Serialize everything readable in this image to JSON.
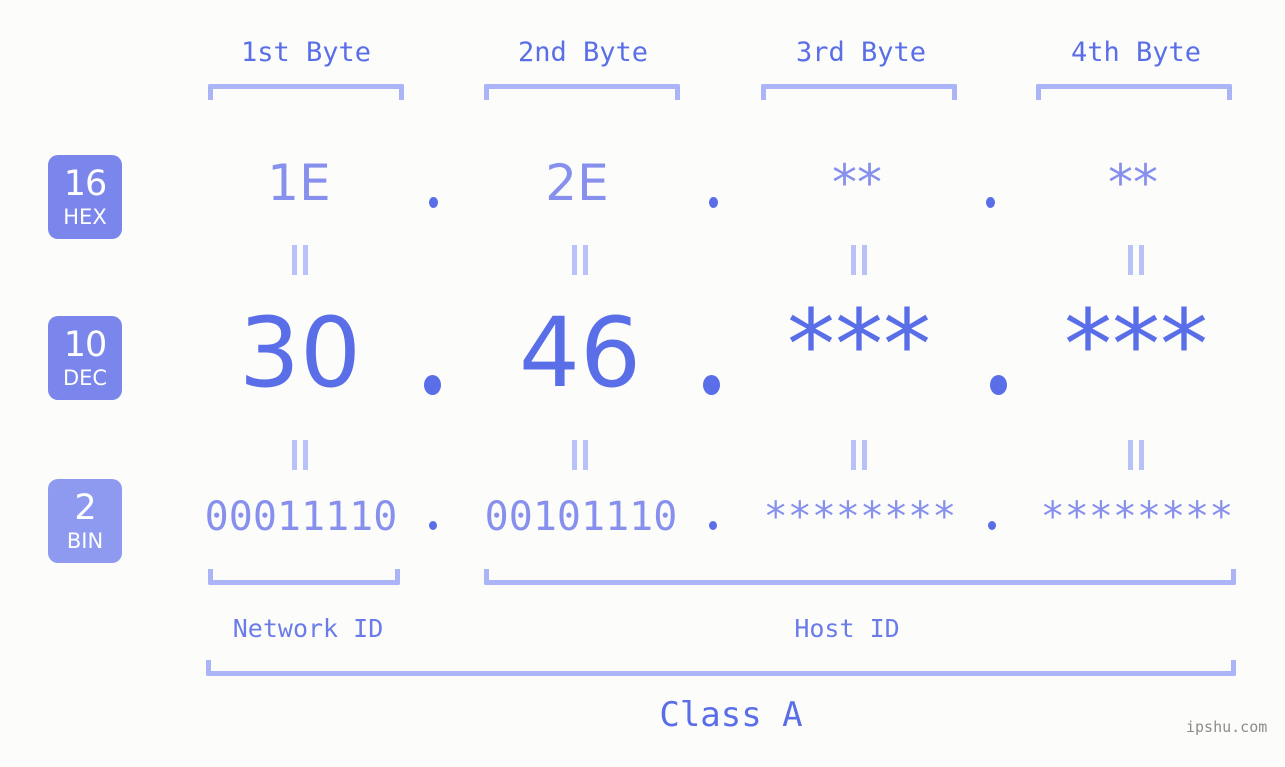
{
  "meta": {
    "background_color": "#fcfdfa",
    "accent_color": "#5a6ee8",
    "accent_light_color": "#8791ed",
    "bracket_color": "#aab4f7",
    "badge_color": "#7b86ec",
    "badge_color_light": "#8e9af0",
    "watermark": "ipshu.com"
  },
  "headers": {
    "byte1": "1st Byte",
    "byte2": "2nd Byte",
    "byte3": "3rd Byte",
    "byte4": "4th Byte"
  },
  "rows": {
    "hex": {
      "badge_number": "16",
      "badge_name": "HEX",
      "values": [
        "1E",
        "2E",
        "**",
        "**"
      ],
      "separator": "."
    },
    "dec": {
      "badge_number": "10",
      "badge_name": "DEC",
      "values": [
        "30",
        "46",
        "***",
        "***"
      ],
      "separator": "."
    },
    "bin": {
      "badge_number": "2",
      "badge_name": "BIN",
      "values": [
        "00011110",
        "00101110",
        "********",
        "********"
      ],
      "separator": "."
    }
  },
  "equality_symbol": "=",
  "footer": {
    "network_id": "Network ID",
    "host_id": "Host ID",
    "class": "Class A"
  }
}
